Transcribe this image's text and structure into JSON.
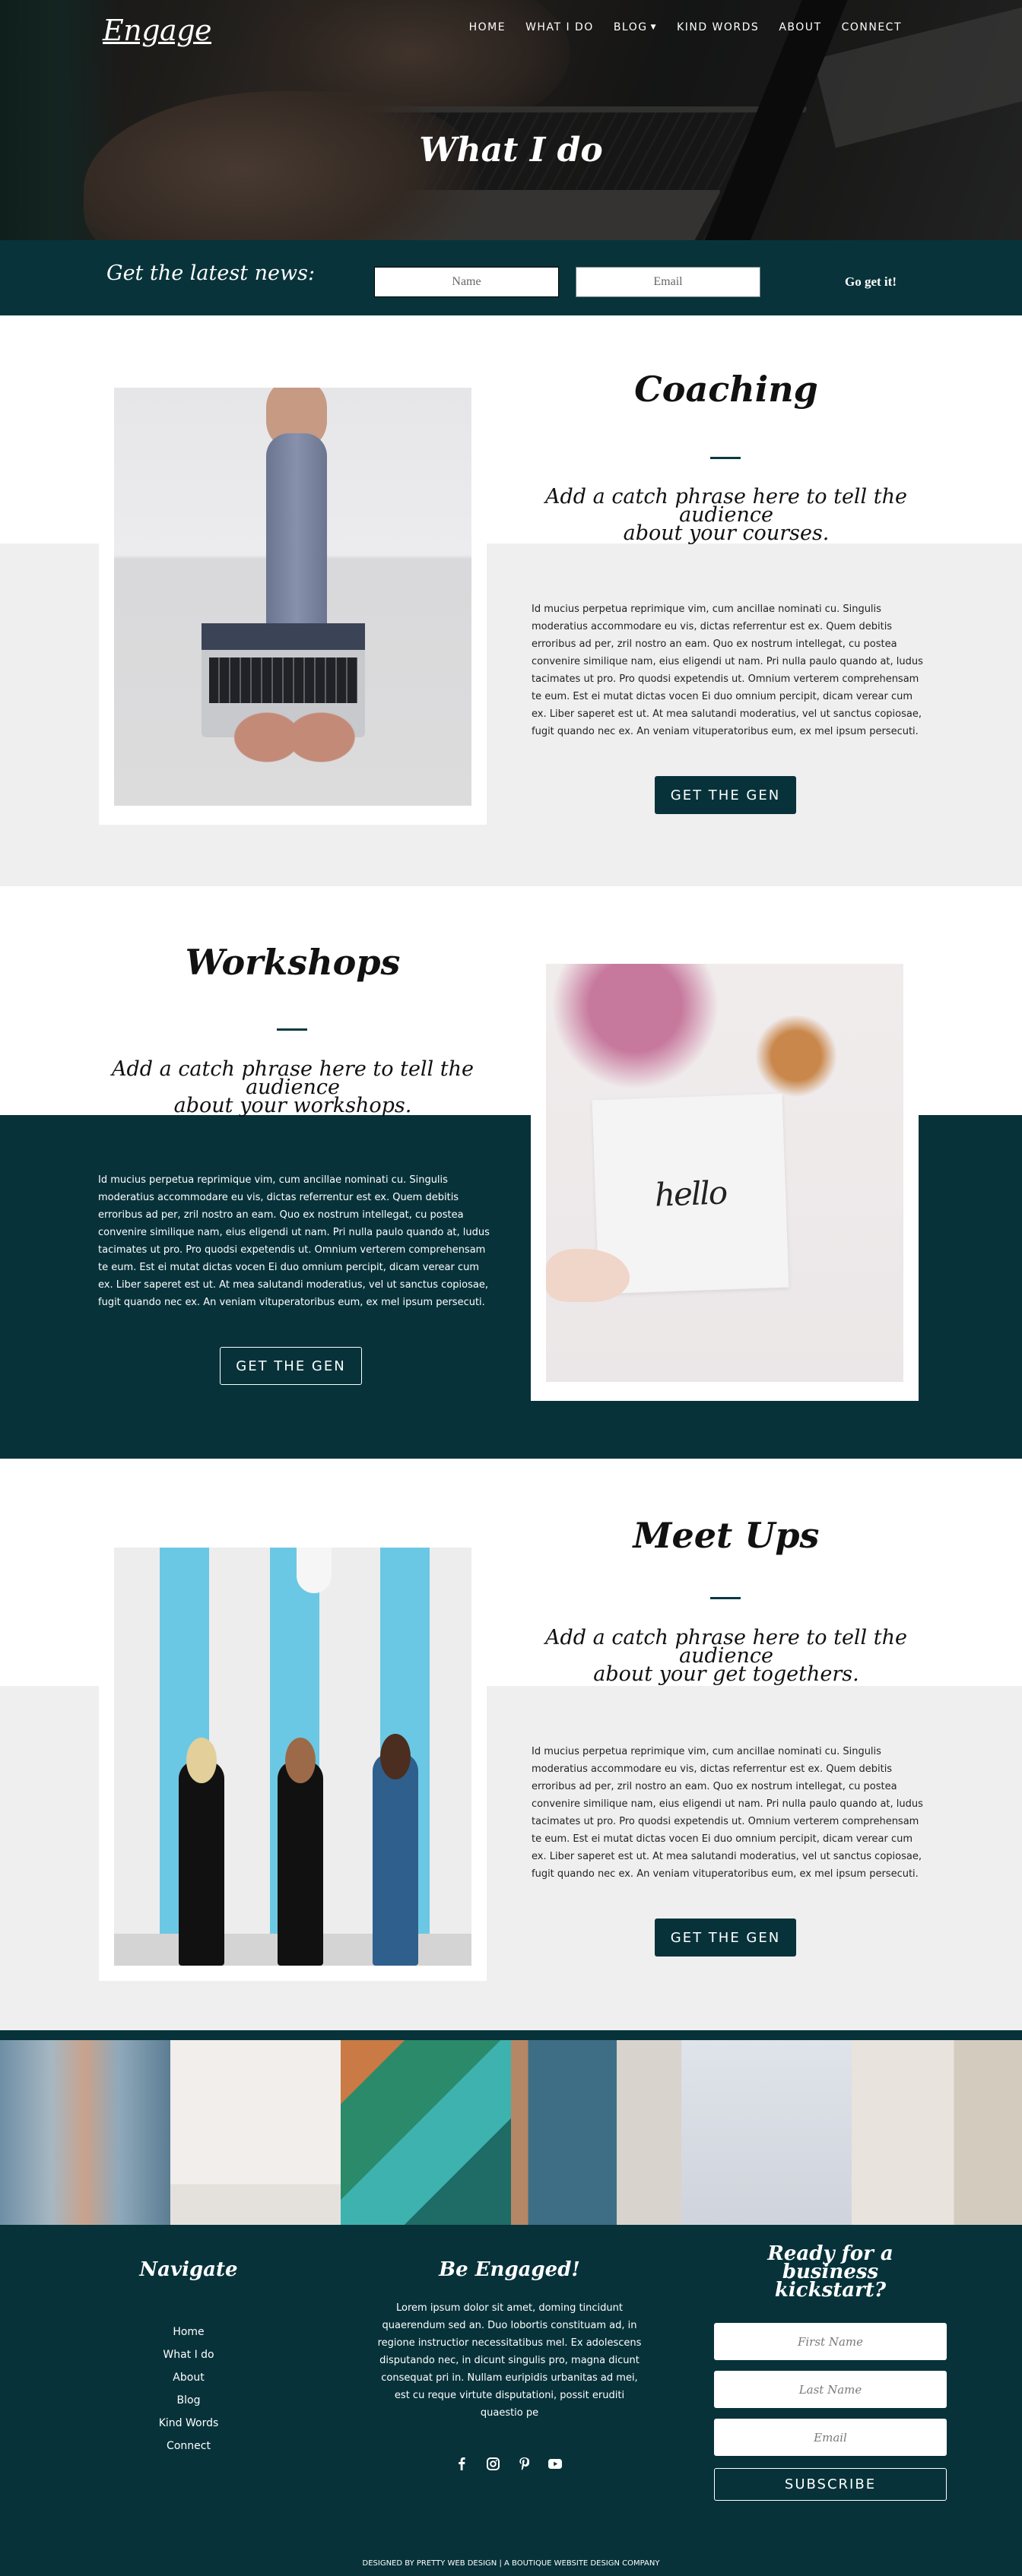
{
  "header": {
    "logo": "Engage",
    "nav": [
      {
        "label": "HOME",
        "has_dropdown": false
      },
      {
        "label": "WHAT I DO",
        "has_dropdown": false
      },
      {
        "label": "BLOG",
        "has_dropdown": true
      },
      {
        "label": "KIND WORDS",
        "has_dropdown": false
      },
      {
        "label": "ABOUT",
        "has_dropdown": false
      },
      {
        "label": "CONNECT",
        "has_dropdown": false
      }
    ],
    "dropdown_icon": "chevron-down-icon"
  },
  "hero": {
    "title": "What I do"
  },
  "newsletter": {
    "label": "Get the latest news:",
    "name_placeholder": "Name",
    "email_placeholder": "Email",
    "submit_label": "Go get it!"
  },
  "sections": [
    {
      "id": "coaching",
      "title": "Coaching",
      "catchphrase_line1": "Add a catch phrase here to tell the audience",
      "catchphrase_line2": "about your courses.",
      "body": "Id mucius perpetua reprimique vim, cum ancillae nominati cu. Singulis moderatius accommodare eu vis, dictas referrentur est ex. Quem debitis erroribus ad per, zril nostro an eam. Quo ex nostrum intellegat, cu postea convenire similique nam, eius eligendi ut nam. Pri nulla paulo quando at, ludus tacimates ut pro. Pro quodsi expetendis ut. Omnium verterem comprehensam te eum. Est ei mutat dictas vocen Ei duo omnium percipit, dicam verear cum ex. Liber saperet est ut. At mea salutandi moderatius, vel ut sanctus copiosae, fugit quando nec ex. An veniam vituperatoribus eum, ex mel ipsum persecuti.",
      "button_label": "GET THE GEN",
      "image_alt": "woman typing on laptop on couch"
    },
    {
      "id": "workshops",
      "title": "Workshops",
      "catchphrase_line1": "Add a catch phrase here to tell the audience",
      "catchphrase_line2": "about your workshops.",
      "body": "Id mucius perpetua reprimique vim, cum ancillae nominati cu. Singulis moderatius accommodare eu vis, dictas referrentur est ex. Quem debitis erroribus ad per, zril nostro an eam. Quo ex nostrum intellegat, cu postea convenire similique nam, eius eligendi ut nam. Pri nulla paulo quando at, ludus tacimates ut pro. Pro quodsi expetendis ut. Omnium verterem comprehensam te eum. Est ei mutat dictas vocen Ei duo omnium percipit, dicam verear cum ex. Liber saperet est ut. At mea salutandi moderatius, vel ut sanctus copiosae, fugit quando nec ex. An veniam vituperatoribus eum, ex mel ipsum persecuti.",
      "button_label": "GET THE GEN",
      "image_text": "hello",
      "image_alt": "hand holding hello card"
    },
    {
      "id": "meetups",
      "title": "Meet Ups",
      "catchphrase_line1": "Add a catch phrase here to tell the audience",
      "catchphrase_line2": "about your get togethers.",
      "body": "Id mucius perpetua reprimique vim, cum ancillae nominati cu. Singulis moderatius accommodare eu vis, dictas referrentur est ex. Quem debitis erroribus ad per, zril nostro an eam. Quo ex nostrum intellegat, cu postea convenire similique nam, eius eligendi ut nam. Pri nulla paulo quando at, ludus tacimates ut pro. Pro quodsi expetendis ut. Omnium verterem comprehensam te eum. Est ei mutat dictas vocen Ei duo omnium percipit, dicam verear cum ex. Liber saperet est ut. At mea salutandi moderatius, vel ut sanctus copiosae, fugit quando nec ex. An veniam vituperatoribus eum, ex mel ipsum persecuti.",
      "button_label": "GET THE GEN",
      "image_alt": "three women holding hands by striped wall"
    }
  ],
  "gallery": {
    "tiles": [
      "feathers",
      "wall-hanging",
      "tea-table",
      "patterned-dress-bag",
      "ukulele",
      "boho-room"
    ]
  },
  "footer": {
    "navigate": {
      "heading": "Navigate",
      "links": [
        "Home",
        "What I do",
        "About",
        "Blog",
        "Kind Words",
        "Connect"
      ]
    },
    "engaged": {
      "heading": "Be Engaged!",
      "text": "Lorem ipsum dolor sit amet, doming tincidunt quaerendum sed an. Duo lobortis constituam ad, in regione instructior necessitatibus mel. Ex adolescens disputando nec, in dicunt singulis pro, magna dicunt consequat pri in. Nullam euripidis urbanitas ad mei, est cu reque virtute disputationi, possit eruditi quaestio pe",
      "socials": [
        "facebook-icon",
        "instagram-icon",
        "pinterest-icon",
        "youtube-icon"
      ]
    },
    "signup": {
      "heading_line1": "Ready for a business",
      "heading_line2": "kickstart?",
      "first_name_placeholder": "First Name",
      "last_name_placeholder": "Last Name",
      "email_placeholder": "Email",
      "subscribe_label": "SUBSCRIBE"
    },
    "credit": "DESIGNED BY PRETTY WEB DESIGN | A BOUTIQUE WEBSITE DESIGN COMPANY"
  },
  "colors": {
    "brand_dark_teal": "#07323a",
    "light_gray_band": "#efefef",
    "white": "#ffffff"
  }
}
